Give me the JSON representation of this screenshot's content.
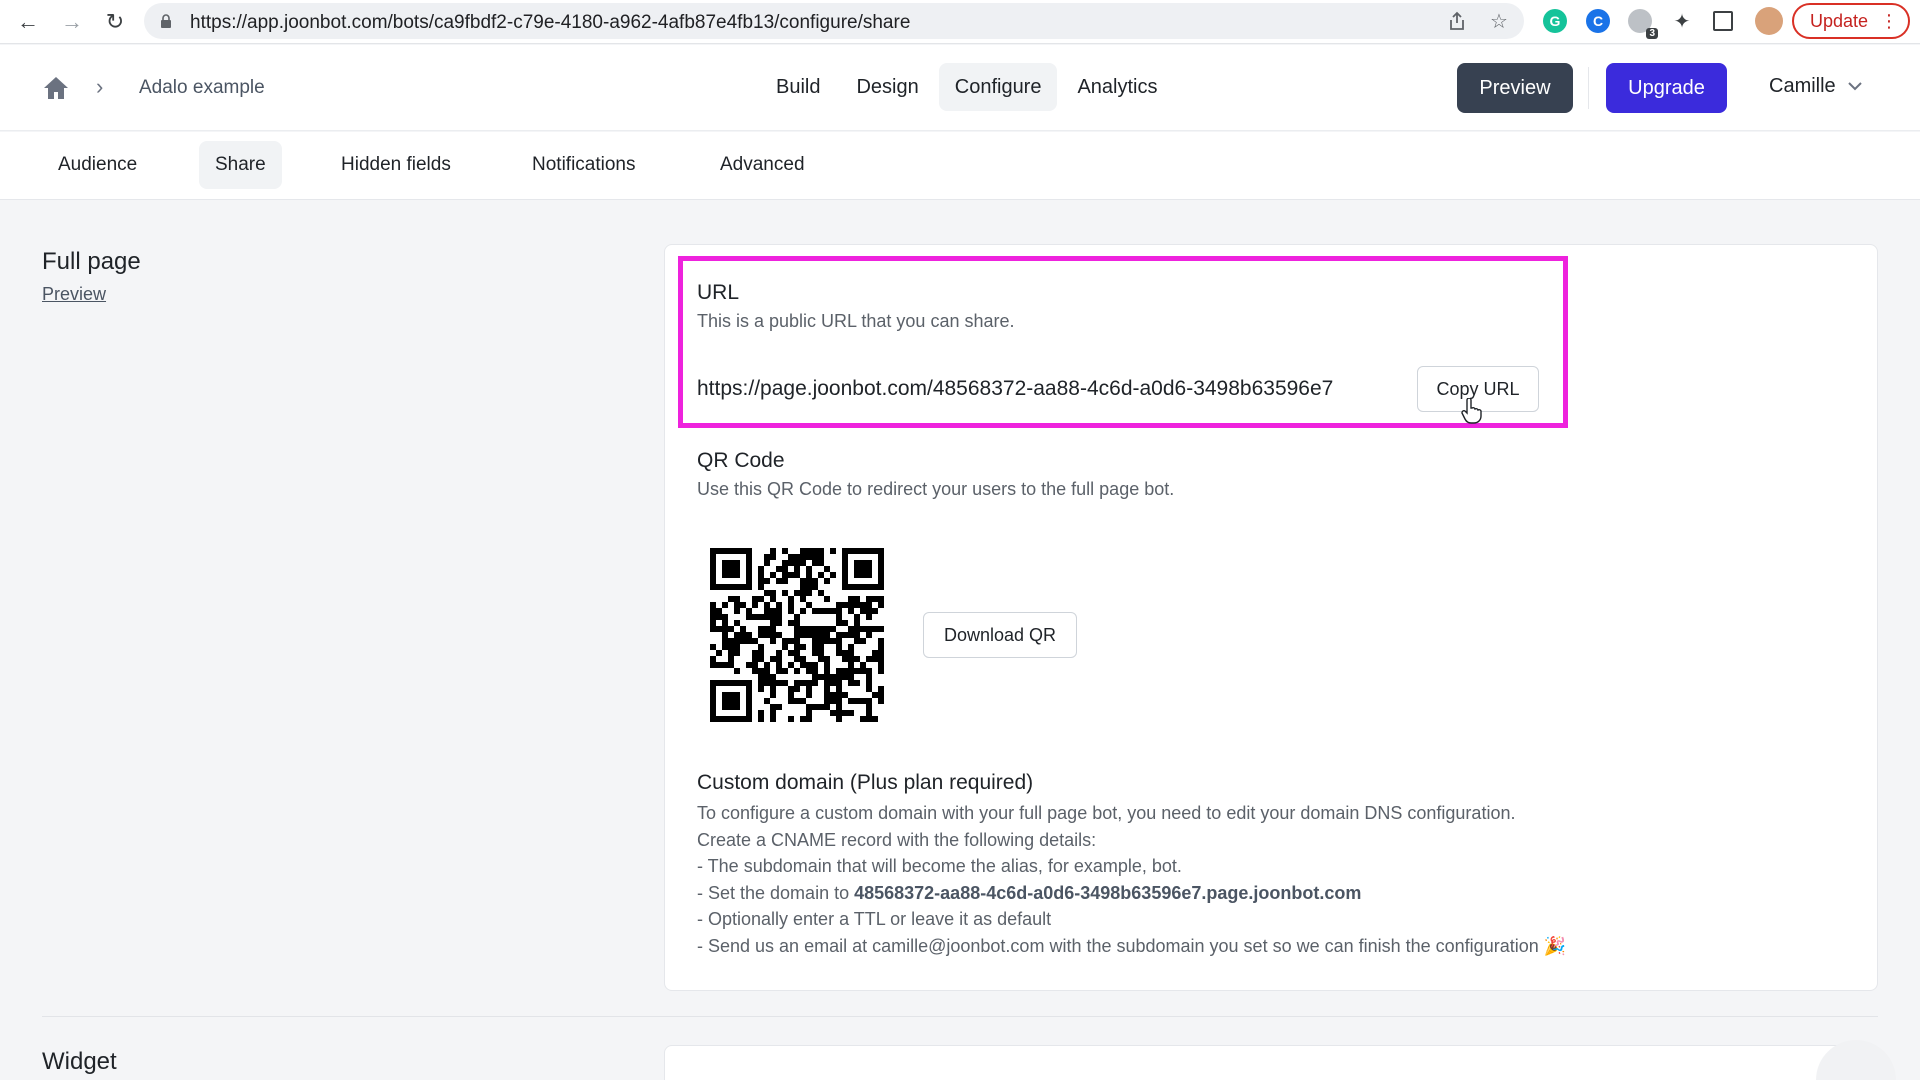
{
  "browser": {
    "url": "https://app.joonbot.com/bots/ca9fbdf2-c79e-4180-a962-4afb87e4fb13/configure/share",
    "update_label": "Update",
    "extension_badge": "3"
  },
  "header": {
    "breadcrumb": "Adalo example",
    "tabs": [
      {
        "label": "Build"
      },
      {
        "label": "Design"
      },
      {
        "label": "Configure",
        "active": true
      },
      {
        "label": "Analytics"
      }
    ],
    "preview_label": "Preview",
    "upgrade_label": "Upgrade",
    "user_name": "Camille"
  },
  "subtabs": [
    {
      "label": "Audience"
    },
    {
      "label": "Share",
      "active": true
    },
    {
      "label": "Hidden fields"
    },
    {
      "label": "Notifications"
    },
    {
      "label": "Advanced"
    }
  ],
  "full_page": {
    "title": "Full page",
    "preview_link": "Preview",
    "url_block": {
      "title": "URL",
      "description": "This is a public URL that you can share.",
      "value": "https://page.joonbot.com/48568372-aa88-4c6d-a0d6-3498b63596e7",
      "copy_label": "Copy URL"
    },
    "qr_block": {
      "title": "QR Code",
      "description": "Use this QR Code to redirect your users to the full page bot.",
      "download_label": "Download QR"
    },
    "domain_block": {
      "title": "Custom domain (Plus plan required)",
      "line1": "To configure a custom domain with your full page bot, you need to edit your domain DNS configuration.",
      "line2": "Create a CNAME record with the following details:",
      "line3": "- The subdomain that will become the alias, for example, bot.",
      "line4_prefix": "- Set the domain to ",
      "line4_domain": "48568372-aa88-4c6d-a0d6-3498b63596e7.page.joonbot.com",
      "line5": "- Optionally enter a TTL or leave it as default",
      "line6": "- Send us an email at camille@joonbot.com with the subdomain you set so we can finish the configuration 🎉"
    }
  },
  "widget": {
    "title": "Widget"
  },
  "colors": {
    "accent": "#3b2bdc",
    "preview_button": "#374151",
    "highlight": "#ee22dd"
  }
}
